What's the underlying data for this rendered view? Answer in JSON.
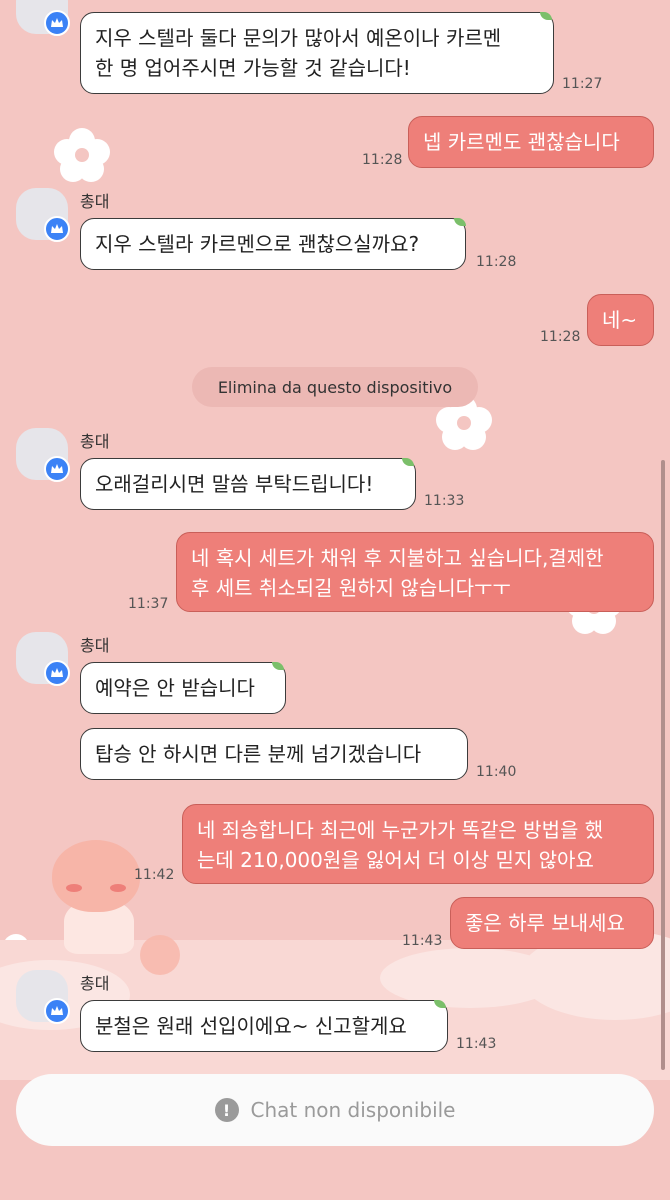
{
  "chat": {
    "sender_name": "총대",
    "system_message": "Elimina da questo dispositivo",
    "footer_status": "Chat non disponibile",
    "messages": [
      {
        "dir": "in",
        "text": "지우 스텔라 둘다 문의가 많아서 예온이나 카르멘\n한 명 업어주시면 가능할 것 같습니다!",
        "time": "11:27"
      },
      {
        "dir": "out",
        "text": "넵 카르멘도 괜찮습니다",
        "time": "11:28"
      },
      {
        "dir": "in",
        "text": "지우 스텔라 카르멘으로 괜찮으실까요?",
        "time": "11:28"
      },
      {
        "dir": "out",
        "text": "네~",
        "time": "11:28"
      },
      {
        "dir": "in",
        "text": "오래걸리시면 말씀 부탁드립니다!",
        "time": "11:33"
      },
      {
        "dir": "out",
        "text": "네 혹시 세트가 채워 후 지불하고 싶습니다,결제한\n후 세트 취소되길 원하지 않습니다ㅜㅜ",
        "time": "11:37"
      },
      {
        "dir": "in",
        "text": "예약은 안 받습니다",
        "time": ""
      },
      {
        "dir": "in",
        "text": "탑승 안 하시면 다른 분께 넘기겠습니다",
        "time": "11:40"
      },
      {
        "dir": "out",
        "text": "네 죄송합니다 최근에 누군가가 똑같은 방법을 했\n는데 210,000원을 잃어서 더 이상 믿지 않아요",
        "time": "11:42"
      },
      {
        "dir": "out",
        "text": "좋은 하루 보내세요",
        "time": "11:43"
      },
      {
        "dir": "in",
        "text": "분철은 원래 선입이에요~ 신고할게요",
        "time": "11:43"
      }
    ]
  },
  "colors": {
    "background": "#f4c6c2",
    "outgoing_bubble": "#ee7f79",
    "incoming_bubble": "#ffffff",
    "badge": "#3b82f6"
  },
  "icons": [
    "crown-badge-icon",
    "leaf-icon",
    "alert-icon"
  ]
}
